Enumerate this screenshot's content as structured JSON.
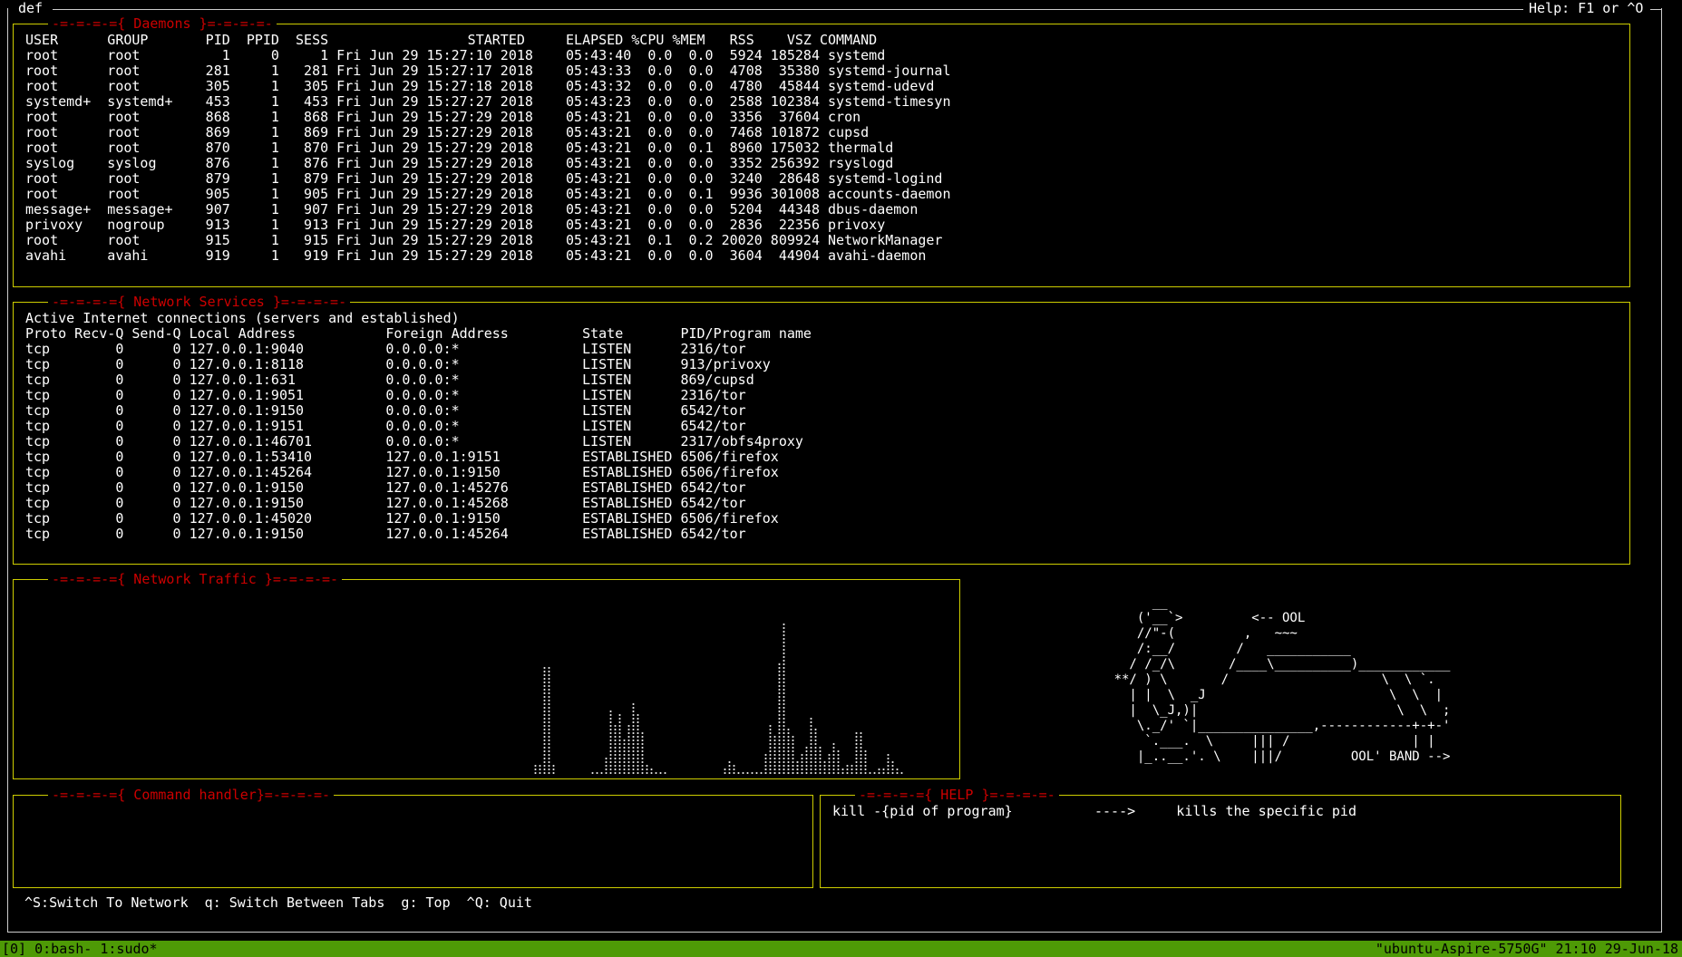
{
  "window": {
    "title": "def",
    "help": "Help: F1 or ^O"
  },
  "daemons": {
    "title": "-=-=-=-={ Daemons }=-=-=-=-",
    "header": "USER      GROUP       PID  PPID  SESS                 STARTED     ELAPSED %CPU %MEM   RSS    VSZ COMMAND",
    "rows": [
      "root      root          1     0     1 Fri Jun 29 15:27:10 2018    05:43:40  0.0  0.0  5924 185284 systemd",
      "root      root        281     1   281 Fri Jun 29 15:27:17 2018    05:43:33  0.0  0.0  4708  35380 systemd-journal",
      "root      root        305     1   305 Fri Jun 29 15:27:18 2018    05:43:32  0.0  0.0  4780  45844 systemd-udevd",
      "systemd+  systemd+    453     1   453 Fri Jun 29 15:27:27 2018    05:43:23  0.0  0.0  2588 102384 systemd-timesyn",
      "root      root        868     1   868 Fri Jun 29 15:27:29 2018    05:43:21  0.0  0.0  3356  37604 cron",
      "root      root        869     1   869 Fri Jun 29 15:27:29 2018    05:43:21  0.0  0.0  7468 101872 cupsd",
      "root      root        870     1   870 Fri Jun 29 15:27:29 2018    05:43:21  0.0  0.1  8960 175032 thermald",
      "syslog    syslog      876     1   876 Fri Jun 29 15:27:29 2018    05:43:21  0.0  0.0  3352 256392 rsyslogd",
      "root      root        879     1   879 Fri Jun 29 15:27:29 2018    05:43:21  0.0  0.0  3240  28648 systemd-logind",
      "root      root        905     1   905 Fri Jun 29 15:27:29 2018    05:43:21  0.0  0.1  9936 301008 accounts-daemon",
      "message+  message+    907     1   907 Fri Jun 29 15:27:29 2018    05:43:21  0.0  0.0  5204  44348 dbus-daemon",
      "privoxy   nogroup     913     1   913 Fri Jun 29 15:27:29 2018    05:43:21  0.0  0.0  2836  22356 privoxy",
      "root      root        915     1   915 Fri Jun 29 15:27:29 2018    05:43:21  0.1  0.2 20020 809924 NetworkManager",
      "avahi     avahi       919     1   919 Fri Jun 29 15:27:29 2018    05:43:21  0.0  0.0  3604  44904 avahi-daemon"
    ]
  },
  "network_services": {
    "title": "-=-=-=-={ Network Services }=-=-=-=-",
    "intro": "Active Internet connections (servers and established)",
    "header": "Proto Recv-Q Send-Q Local Address           Foreign Address         State       PID/Program name",
    "rows": [
      "tcp        0      0 127.0.0.1:9040          0.0.0.0:*               LISTEN      2316/tor",
      "tcp        0      0 127.0.0.1:8118          0.0.0.0:*               LISTEN      913/privoxy",
      "tcp        0      0 127.0.0.1:631           0.0.0.0:*               LISTEN      869/cupsd",
      "tcp        0      0 127.0.0.1:9051          0.0.0.0:*               LISTEN      2316/tor",
      "tcp        0      0 127.0.0.1:9150          0.0.0.0:*               LISTEN      6542/tor",
      "tcp        0      0 127.0.0.1:9151          0.0.0.0:*               LISTEN      6542/tor",
      "tcp        0      0 127.0.0.1:46701         0.0.0.0:*               LISTEN      2317/obfs4proxy",
      "tcp        0      0 127.0.0.1:53410         127.0.0.1:9151          ESTABLISHED 6506/firefox",
      "tcp        0      0 127.0.0.1:45264         127.0.0.1:9150          ESTABLISHED 6506/firefox",
      "tcp        0      0 127.0.0.1:9150          127.0.0.1:45276         ESTABLISHED 6542/tor",
      "tcp        0      0 127.0.0.1:9150          127.0.0.1:45268         ESTABLISHED 6542/tor",
      "tcp        0      0 127.0.0.1:45020         127.0.0.1:9150          ESTABLISHED 6506/firefox",
      "tcp        0      0 127.0.0.1:9150          127.0.0.1:45264         ESTABLISHED 6542/tor"
    ]
  },
  "network_traffic": {
    "title": "-=-=-=-={ Network Traffic }=-=-=-=-",
    "groups": [
      [
        3,
        3,
        30,
        30,
        3
      ],
      [
        1,
        1,
        1,
        5,
        18,
        14,
        17,
        10,
        14,
        20,
        17,
        12,
        3,
        2,
        1,
        1,
        1
      ],
      [
        2,
        4,
        3,
        1,
        1,
        1,
        1,
        1,
        1,
        6,
        14,
        11,
        31,
        42,
        13,
        11,
        4,
        3
      ],
      [
        2,
        2,
        2,
        3,
        3,
        3,
        3,
        4,
        6,
        8,
        16,
        13,
        8,
        4,
        6,
        9,
        7,
        2,
        3,
        3,
        12,
        12,
        7
      ],
      [
        1,
        1,
        2,
        2,
        6,
        4,
        2,
        1
      ]
    ]
  },
  "ascii_art": "           __\n         ('__`>         <-- OOL\n         //\"-(         ,   ~~~\n         /:__/        /   ___________\n        / /_/\\       /____\\__________)____________\n      **/ ) \\       /                    \\  \\ `.\n        | |  \\  _J                        \\  \\  |\n        |  \\_J,)|                          \\  \\  ;\n         \\._/' `|_______________,------------+-+-'\n          `.___.  \\     ||| /                | |\n         |_..__.'. \\    |||/         OOL' BAND -->",
  "command_handler": {
    "title": "-=-=-=-={ Command handler}=-=-=-=-"
  },
  "help_panel": {
    "title": "-=-=-=-={ HELP }=-=-=-=-",
    "line": "kill -{pid of program}          ---->     kills the specific pid"
  },
  "hotkeys": "^S:Switch To Network  q: Switch Between Tabs  g: Top  ^Q: Quit",
  "status_bar": {
    "left": "[0] 0:bash- 1:sudo*",
    "right": "\"ubuntu-Aspire-5750G\" 21:10 29-Jun-18"
  }
}
